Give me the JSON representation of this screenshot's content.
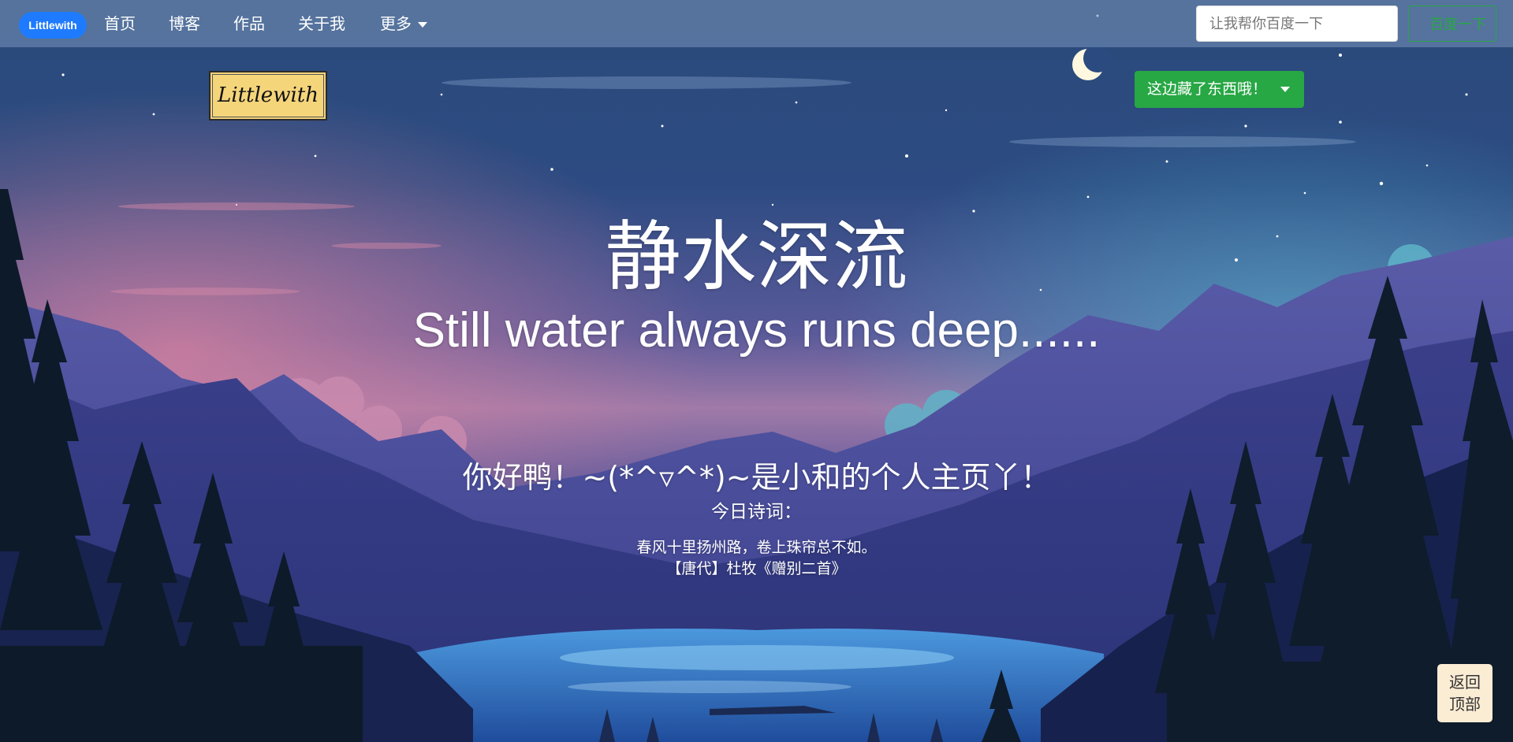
{
  "navbar": {
    "brand": "Littlewith",
    "items": [
      {
        "label": "首页"
      },
      {
        "label": "博客"
      },
      {
        "label": "作品"
      },
      {
        "label": "关于我"
      },
      {
        "label": "更多"
      }
    ],
    "search_placeholder": "让我帮你百度一下",
    "search_button": "百度一下"
  },
  "logo": {
    "text": "Littlewith"
  },
  "secret_dropdown": {
    "label": "这边藏了东西哦！"
  },
  "hero": {
    "title": "静水深流",
    "subtitle": "Still water always runs deep......",
    "greeting": "你好鸭！~(*^▿^*)~是小和的个人主页丫！",
    "poem_label": "今日诗词：",
    "poem_line": "春风十里扬州路，卷上珠帘总不如。",
    "poem_source": "【唐代】杜牧《赠别二首》"
  },
  "back_to_top": {
    "line1": "返回",
    "line2": "顶部"
  },
  "colors": {
    "brand_blue": "#1e7bff",
    "success_green": "#28a745",
    "navbar_bg": "rgba(120,150,185,0.55)",
    "logo_bg": "#f4d57a",
    "back_top_bg": "#fbecd4"
  },
  "icons": {
    "caret": "caret-down-icon",
    "moon": "moon-icon"
  }
}
